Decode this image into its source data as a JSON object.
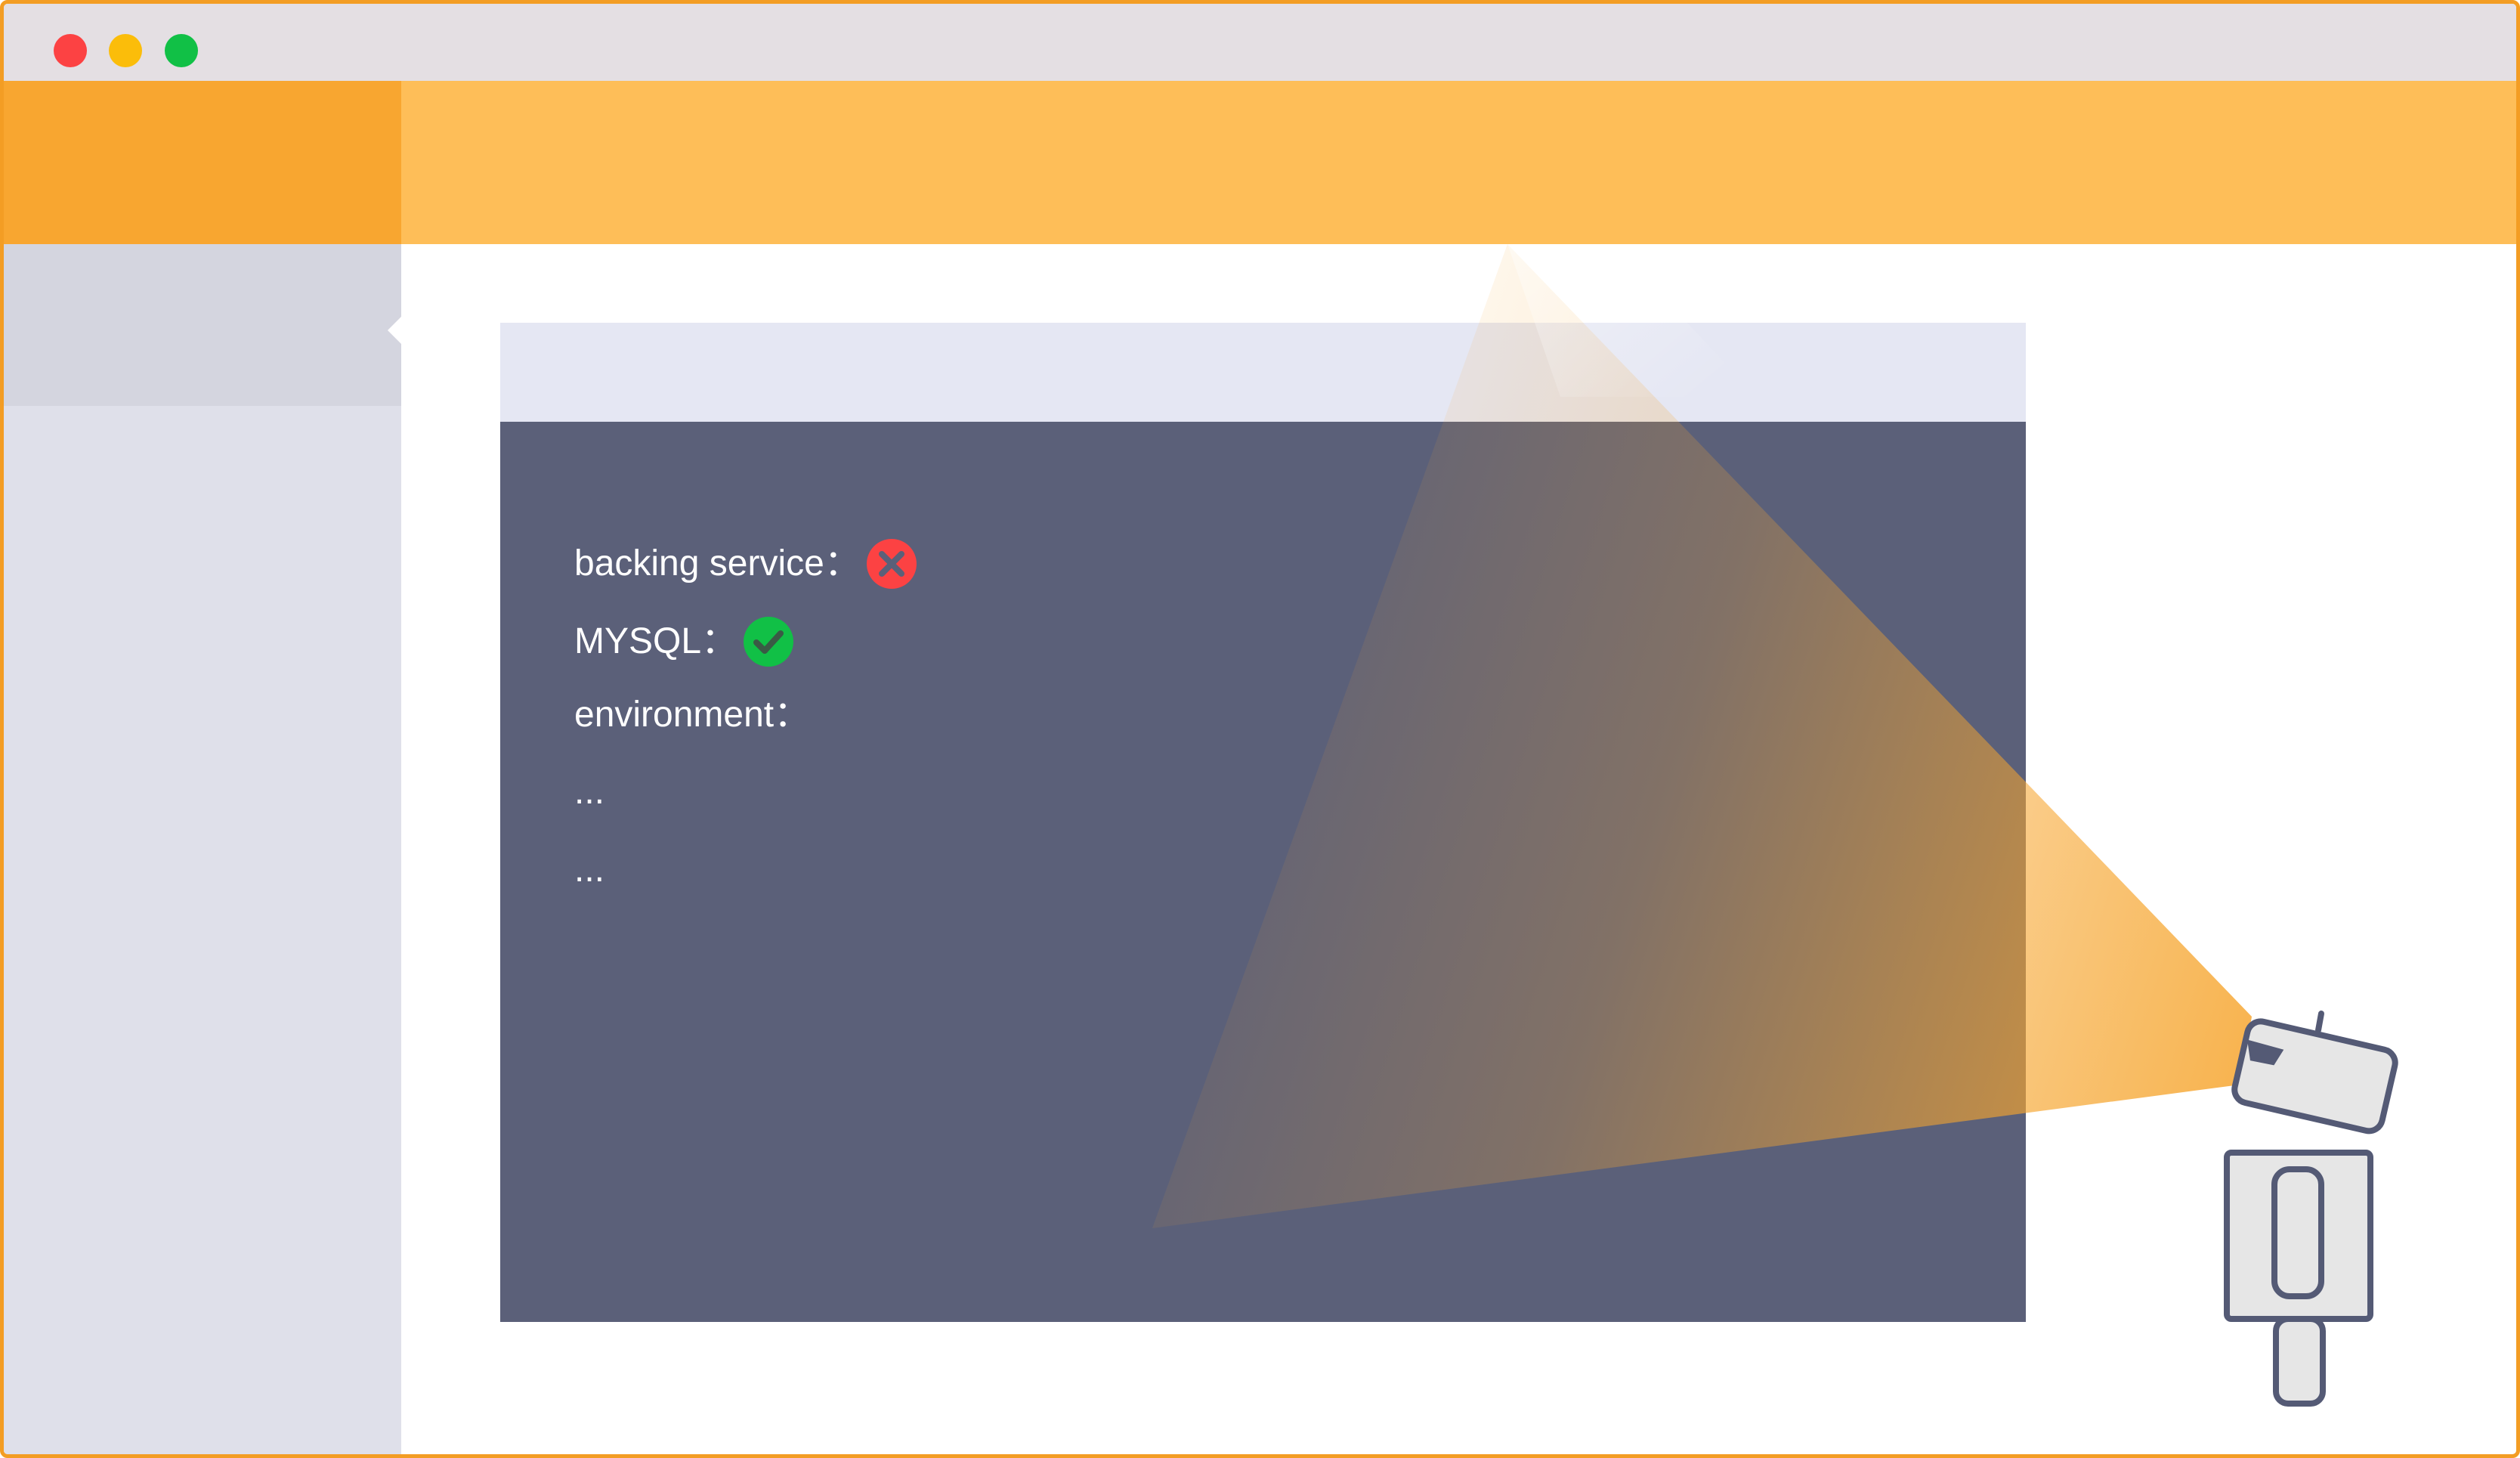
{
  "window": {
    "controls": [
      "close-dot",
      "minimize-dot",
      "maximize-dot"
    ]
  },
  "console": {
    "rows": [
      {
        "label": "backing service：",
        "status": "error"
      },
      {
        "label": "MYSQL：",
        "status": "ok"
      },
      {
        "label": "environment：",
        "status": ""
      },
      {
        "label": "...",
        "status": ""
      },
      {
        "label": "...",
        "status": ""
      }
    ]
  },
  "colors": {
    "window_border": "#f39d24",
    "titlebar": "#e4dfe3",
    "header": "#febe58",
    "header_logo_area": "#f8a630",
    "sidebar": "#dfe0ea",
    "sidebar_active": "#d4d5df",
    "panel_header": "#e5e7f3",
    "panel_body": "#5b6079",
    "status_error": "#fc4243",
    "status_ok": "#11c046",
    "robot_stroke": "#545a75",
    "robot_fill": "#e6e6e6"
  },
  "icons": {
    "error": "x-circle-icon",
    "ok": "check-circle-icon",
    "robot": "camera-robot-icon"
  }
}
